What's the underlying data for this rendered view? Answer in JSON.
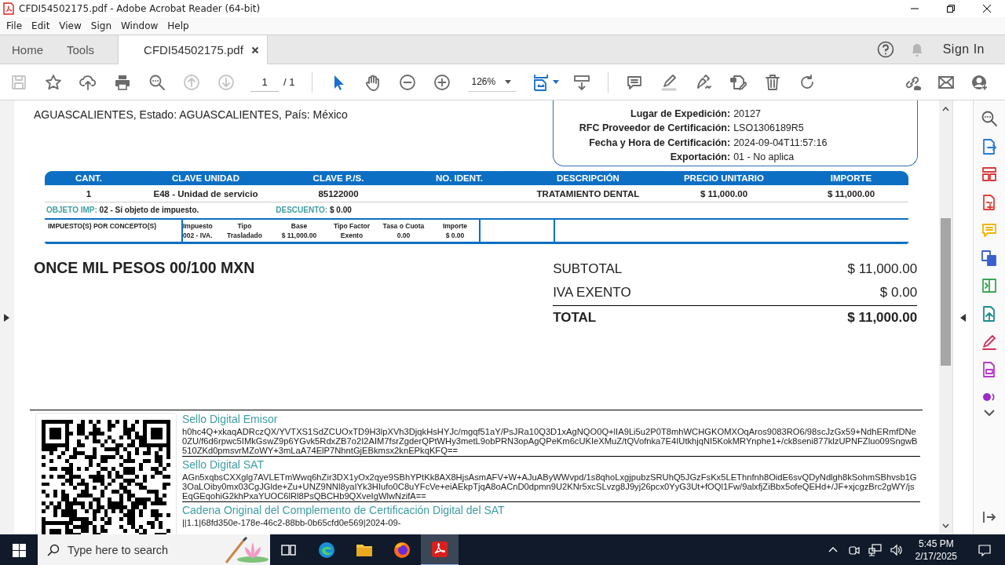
{
  "window": {
    "title": "CFDI54502175.pdf - Adobe Acrobat Reader (64-bit)"
  },
  "menu": [
    "File",
    "Edit",
    "View",
    "Sign",
    "Window",
    "Help"
  ],
  "tabs": [
    {
      "label": "Home",
      "selected": false
    },
    {
      "label": "Tools",
      "selected": false
    },
    {
      "label": "CFDI54502175.pdf",
      "selected": true
    }
  ],
  "account": {
    "sign_in": "Sign In"
  },
  "toolbar": {
    "left": [
      {
        "kind": "save",
        "disabled": true
      },
      {
        "kind": "star",
        "disabled": false
      },
      {
        "kind": "upload",
        "disabled": false
      },
      {
        "kind": "print",
        "disabled": false
      },
      {
        "kind": "find",
        "disabled": false
      },
      {
        "kind": "up",
        "disabled": true
      },
      {
        "kind": "down",
        "disabled": true
      }
    ],
    "page": "1",
    "page_total": "/ 1",
    "middle": [
      {
        "kind": "select",
        "selected": true
      },
      {
        "kind": "hand",
        "selected": false
      },
      {
        "kind": "zoom-out",
        "selected": false
      },
      {
        "kind": "zoom-in",
        "selected": false
      }
    ],
    "zoom": "126%",
    "tools": [
      {
        "kind": "comment"
      },
      {
        "kind": "highlight"
      },
      {
        "kind": "sign"
      },
      {
        "kind": "edit"
      },
      {
        "kind": "trash"
      },
      {
        "kind": "rotate"
      }
    ],
    "right": [
      {
        "kind": "link"
      },
      {
        "kind": "mail"
      },
      {
        "kind": "user"
      }
    ]
  },
  "document": {
    "address": "AGUASCALIENTES, Estado: AGUASCALIENTES, País: México",
    "certificate": [
      {
        "label": "Lugar de Expedición:",
        "value": "20127"
      },
      {
        "label": "RFC Proveedor de Certificación:",
        "value": "LSO1306189R5"
      },
      {
        "label": "Fecha y Hora de Certificación:",
        "value": "2024-09-04T11:57:16"
      },
      {
        "label": "Exportación:",
        "value": "01 - No aplica"
      }
    ],
    "table": {
      "columns": [
        "CANT.",
        "CLAVE UNIDAD",
        "CLAVE P./S.",
        "NO. IDENT.",
        "DESCRIPCIÓN",
        "PRECIO UNITARIO",
        "IMPORTE"
      ],
      "rows": [
        [
          "1",
          "E48 - Unidad de servicio",
          "85122000",
          "",
          "TRATAMIENTO DENTAL",
          "$ 11,000.00",
          "$ 11,000.00"
        ]
      ]
    },
    "objeto_imp": {
      "label": "OBJETO IMP:",
      "value": "02 - Sí objeto de impuesto."
    },
    "descuento": {
      "label": "DESCUENTO:",
      "value": "$ 0.00"
    },
    "taxes": {
      "title": "IMPUESTO(S) POR CONCEPTO(S)",
      "columns": [
        "Impuesto",
        "Tipo",
        "Base",
        "Tipo Factor",
        "Tasa o Cuota",
        "Importe"
      ],
      "values": [
        "002 - IVA.",
        "Trasladado",
        "$ 11,000.00",
        "Exento",
        "0.00",
        "$ 0.00"
      ]
    },
    "amount_in_words": "ONCE MIL PESOS 00/100 MXN",
    "totals": [
      {
        "label": "SUBTOTAL",
        "value": "$ 11,000.00",
        "kind": "line"
      },
      {
        "label": "IVA EXENTO",
        "value": "$ 0.00",
        "kind": "line"
      },
      {
        "label": "TOTAL",
        "value": "$ 11,000.00",
        "kind": "total"
      }
    ],
    "seals": [
      {
        "title": "Sello Digital Emisor",
        "text": "h0hc4Q+xkaqADRczQX/YVTXS1SdZCUOxTD9H3lpXVh3DjqkHsHYJc/mgqf51aY/PsJRa10Q3D1xAgNQO0Q+lIA9Li5u2P0T8mhWCHGKOMXOqAros9083RO6/98scJzGx59+NdhERmfDNe0ZU/f6d6rpwc5IMkGswZ9p6YGvk5RdxZB7o2I2AIM7fsrZgderQPtWHy3metL9obPRN3opAgQPeKm6cUKIeXMuZ/tQVofnka7E4IUtkhjqNI5KokMRYnphe1+/ck8seni877klzUPNFZluo09SngwB510ZKd0pmsvrMZoWY+3mLaA74ElP7NhntGjEBkmsx2knEPkqKFQ=="
      },
      {
        "title": "Sello Digital SAT",
        "text": "AGn5xqbsCXXglg7AVLETmWwq6hZir3DX1yOx2qye9SBhYPtKk8AX8HjsAsmAFV+W+AJuAByWWvpd/1s8qhoLxgjpubzSRUhQ5JGzFsKx5LEThnfnh8OidE6svQDyNdlgh8kSohmSBhvsb1G3OaLOiby0mx03CgJGlde+Zu+UNZ9NNl8yaIYk3HIufo0C8uYFcVe+eiAEkpTjqA8oACnD0dpmn9U2KNr5xcSLvzg8J9yj26pcx0YyG3Ut+fOQl1Fw/9alxfjZiBbx5ofeQEHd+/JF+xjcgzBrc2gWY/jsEqGEqohiG2khPxaYUOC6lRl8PsQBCHb9QXveIgWlwNzifA=="
      },
      {
        "title": "Cadena Original del Complemento de Certificación Digital del SAT",
        "text": "||1.1|68fd350e-178e-46c2-88bb-0b65cfd0e569|2024-09-"
      }
    ]
  },
  "side_tools": [
    {
      "kind": "find",
      "color": "#5a5a5a"
    },
    {
      "kind": "export",
      "color": "#2b7bd4"
    },
    {
      "kind": "organize",
      "color": "#d93a3a"
    },
    {
      "kind": "create",
      "color": "#e0403a"
    },
    {
      "kind": "comment",
      "color": "#f2b400"
    },
    {
      "kind": "combine",
      "color": "#3a5fd0"
    },
    {
      "kind": "compress",
      "color": "#3aa655"
    },
    {
      "kind": "send",
      "color": "#1e8c8c"
    },
    {
      "kind": "fill",
      "color": "#d2335a"
    },
    {
      "kind": "protect",
      "color": "#b43cc8"
    },
    {
      "kind": "more",
      "color": "#9b2cc8"
    }
  ],
  "taskbar": {
    "search_placeholder": "Type here to search",
    "apps": [
      {
        "kind": "taskview",
        "selected": false
      },
      {
        "kind": "edge",
        "selected": false
      },
      {
        "kind": "explorer",
        "selected": false
      },
      {
        "kind": "firefox",
        "selected": false
      },
      {
        "kind": "acrobat",
        "selected": true
      }
    ],
    "time": "5:45 PM",
    "date": "2/17/2025"
  }
}
